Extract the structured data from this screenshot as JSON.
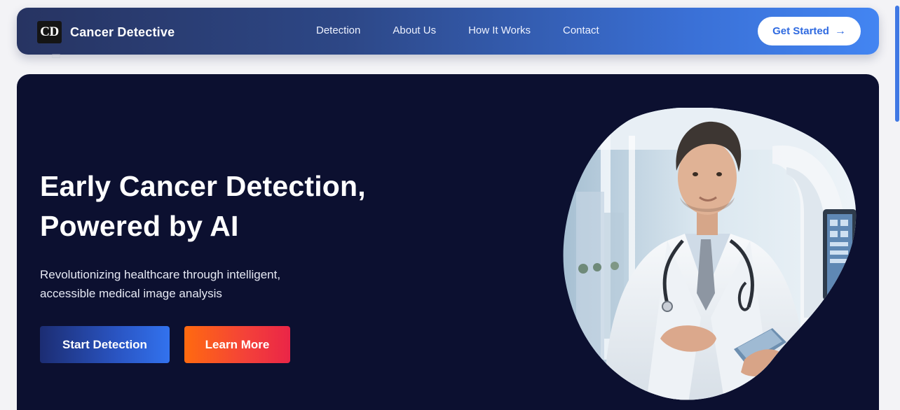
{
  "nav": {
    "logo_text": "CD",
    "brand": "Cancer Detective",
    "links": [
      "Detection",
      "About Us",
      "How It Works",
      "Contact"
    ],
    "cta": "Get Started",
    "cta_icon": "arrow-right-icon"
  },
  "hero": {
    "headline_line1": "Early Cancer Detection,",
    "headline_line2": "Powered by AI",
    "subtext_line1": "Revolutionizing healthcare through intelligent,",
    "subtext_line2": "accessible medical image analysis",
    "primary_button": "Start Detection",
    "secondary_button": "Learn More",
    "image_subject": "doctor-with-tablet-illustration"
  },
  "colors": {
    "nav_gradient_start": "#273462",
    "nav_gradient_end": "#4385f2",
    "hero_bg": "#0c1030",
    "cta_text": "#2f6ae0",
    "primary_btn": "#2a55c3",
    "secondary_btn": "#f3403a"
  }
}
